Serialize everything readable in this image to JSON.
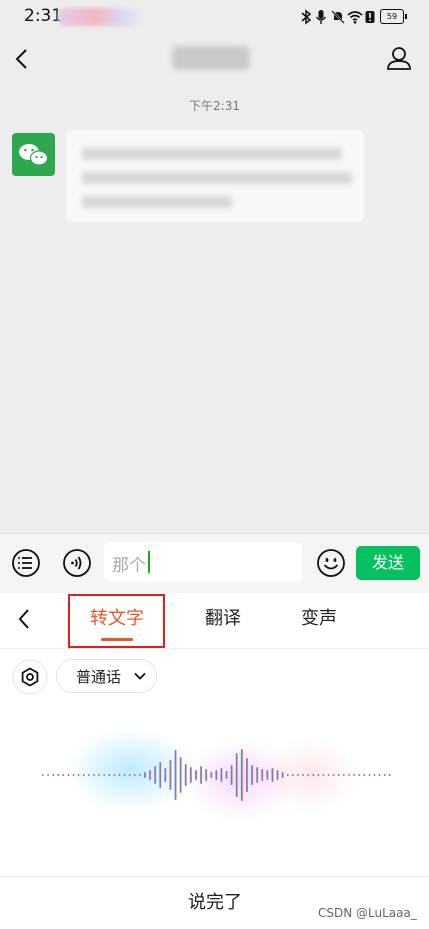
{
  "status_bar": {
    "time": "2:31",
    "battery": "59"
  },
  "chat": {
    "timestamp": "下午2:31"
  },
  "input_bar": {
    "input_value": "那个",
    "send_label": "发送"
  },
  "voice_panel": {
    "tabs": [
      {
        "label": "转文字",
        "active": true
      },
      {
        "label": "翻译",
        "active": false
      },
      {
        "label": "变声",
        "active": false
      }
    ],
    "language": "普通话",
    "finish_label": "说完了",
    "accent_color": "#e8562a",
    "highlight_color": "#e02020"
  },
  "watermark": "CSDN @LuLaaa_",
  "colors": {
    "send_green": "#07c160",
    "wechat_green": "#2ea84f"
  }
}
